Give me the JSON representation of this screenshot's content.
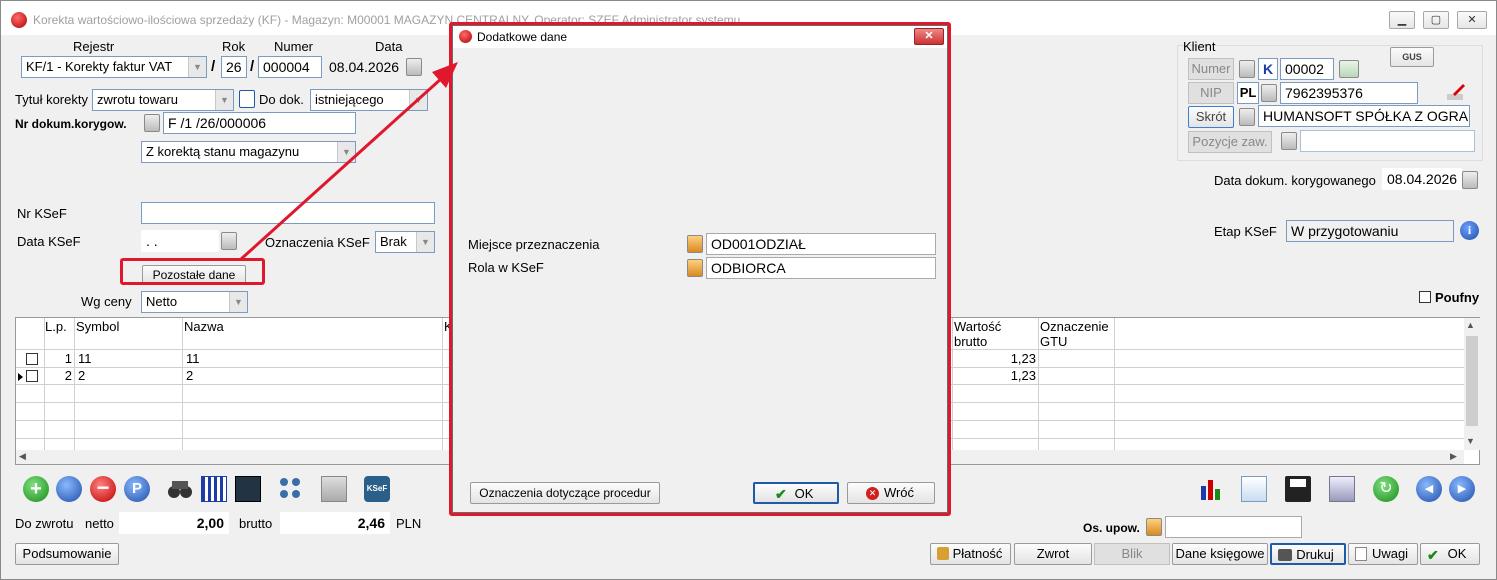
{
  "window": {
    "title": "Korekta wartościowo-ilościowa sprzedaży (KF) - Magazyn: M00001 MAGAZYN CENTRALNY, Operator: SZEF Administrator systemu"
  },
  "header": {
    "rejestr_label": "Rejestr",
    "rok_label": "Rok",
    "numer_label": "Numer",
    "data_label": "Data",
    "rejestr_value": "KF/1   - Korekty faktur VAT",
    "slash1": "/",
    "rok_value": "26",
    "slash2": "/",
    "numer_value": "000004",
    "data_value": "08.04.2026",
    "tytul_label": "Tytuł korekty",
    "tytul_value": "zwrotu towaru",
    "do_dok_label": "Do dok.",
    "do_dok_value": "istniejącego",
    "nr_dok_label": "Nr dokum.korygow.",
    "nr_dok_value": "F /1  /26/000006",
    "korekta_stanu": "Z korektą stanu magazynu",
    "nr_ksef_label": "Nr KSeF",
    "nr_ksef_value": "",
    "data_ksef_label": "Data KSeF",
    "data_ksef_value": " .  .",
    "oznaczenia_label": "Oznaczenia KSeF",
    "oznaczenia_value": "Brak",
    "pozostale_btn": "Pozostałe dane",
    "wg_ceny_label": "Wg ceny",
    "wg_ceny_value": "Netto"
  },
  "client": {
    "klient_label": "Klient",
    "gus": "GUS",
    "numer_btn": "Numer",
    "k_badge": "K",
    "numer_value": "00002",
    "nip_btn": "NIP",
    "pl": "PL",
    "nip_value": "7962395376",
    "skrot_btn": "Skrót",
    "skrot_value": "HUMANSOFT SPÓŁKA Z OGRA",
    "pozycje_btn": "Pozycje zaw.",
    "pozycje_value": "",
    "data_kor_label": "Data dokum. korygowanego",
    "data_kor_value": "08.04.2026",
    "etap_label": "Etap KSeF",
    "etap_value": "W przygotowaniu",
    "poufny_label": "Poufny"
  },
  "grid": {
    "headers": {
      "lp": "L.p.",
      "symbol": "Symbol",
      "nazwa": "Nazwa",
      "k": "K",
      "wartosc1": "Wartość",
      "wartosc2": "brutto",
      "gtu1": "Oznaczenie",
      "gtu2": "GTU"
    },
    "rows": [
      {
        "lp": "1",
        "symbol": "11",
        "nazwa": "11",
        "brutto": "1,23"
      },
      {
        "lp": "2",
        "symbol": "2",
        "nazwa": "2",
        "brutto": "1,23"
      }
    ]
  },
  "totals": {
    "do_zwrotu_label": "Do zwrotu",
    "netto_label": "netto",
    "netto_value": "2,00",
    "brutto_label": "brutto",
    "brutto_value": "2,46",
    "currency": "PLN",
    "os_upow_label": "Os. upow.",
    "os_upow_value": ""
  },
  "bottom": {
    "podsumowanie": "Podsumowanie",
    "platnosc": "Płatność",
    "zwrot": "Zwrot",
    "blik": "Blik",
    "dane_ksiegowe": "Dane księgowe",
    "drukuj": "Drukuj",
    "uwagi": "Uwagi",
    "ok": "OK"
  },
  "dialog": {
    "title": "Dodatkowe dane",
    "close": "✕",
    "miejsce_label": "Miejsce przeznaczenia",
    "miejsce_value": "OD001ODZIAŁ",
    "rola_label": "Rola w KSeF",
    "rola_value": "ODBIORCA",
    "oznaczenia_btn": "Oznaczenia dotyczące procedur",
    "ok_btn": "OK",
    "wroc_btn": "Wróć"
  },
  "colors": {
    "highlight": "#e0182d",
    "accent": "#1e5aa8"
  }
}
